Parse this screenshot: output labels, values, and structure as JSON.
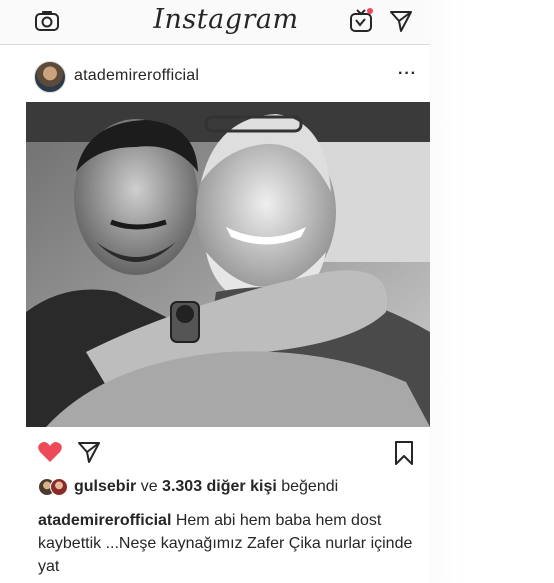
{
  "topbar": {
    "logo": "Instagram",
    "icons": [
      "camera-icon",
      "igtv-icon",
      "direct-message-icon"
    ],
    "notification_color": "#ed4956"
  },
  "post": {
    "username": "atademirerofficial",
    "more_label": "···",
    "liked": true,
    "heart_color": "#ed4956",
    "likes": {
      "first_user": "gulsebir",
      "connector": "ve",
      "others": "3.303 diğer kişi",
      "suffix": "beğendi"
    },
    "caption": {
      "username": "atademirerofficial",
      "text": "Hem abi hem baba hem dost kaybettik ...Neşe kaynağımız Zafer Çika nurlar içinde yat"
    }
  }
}
